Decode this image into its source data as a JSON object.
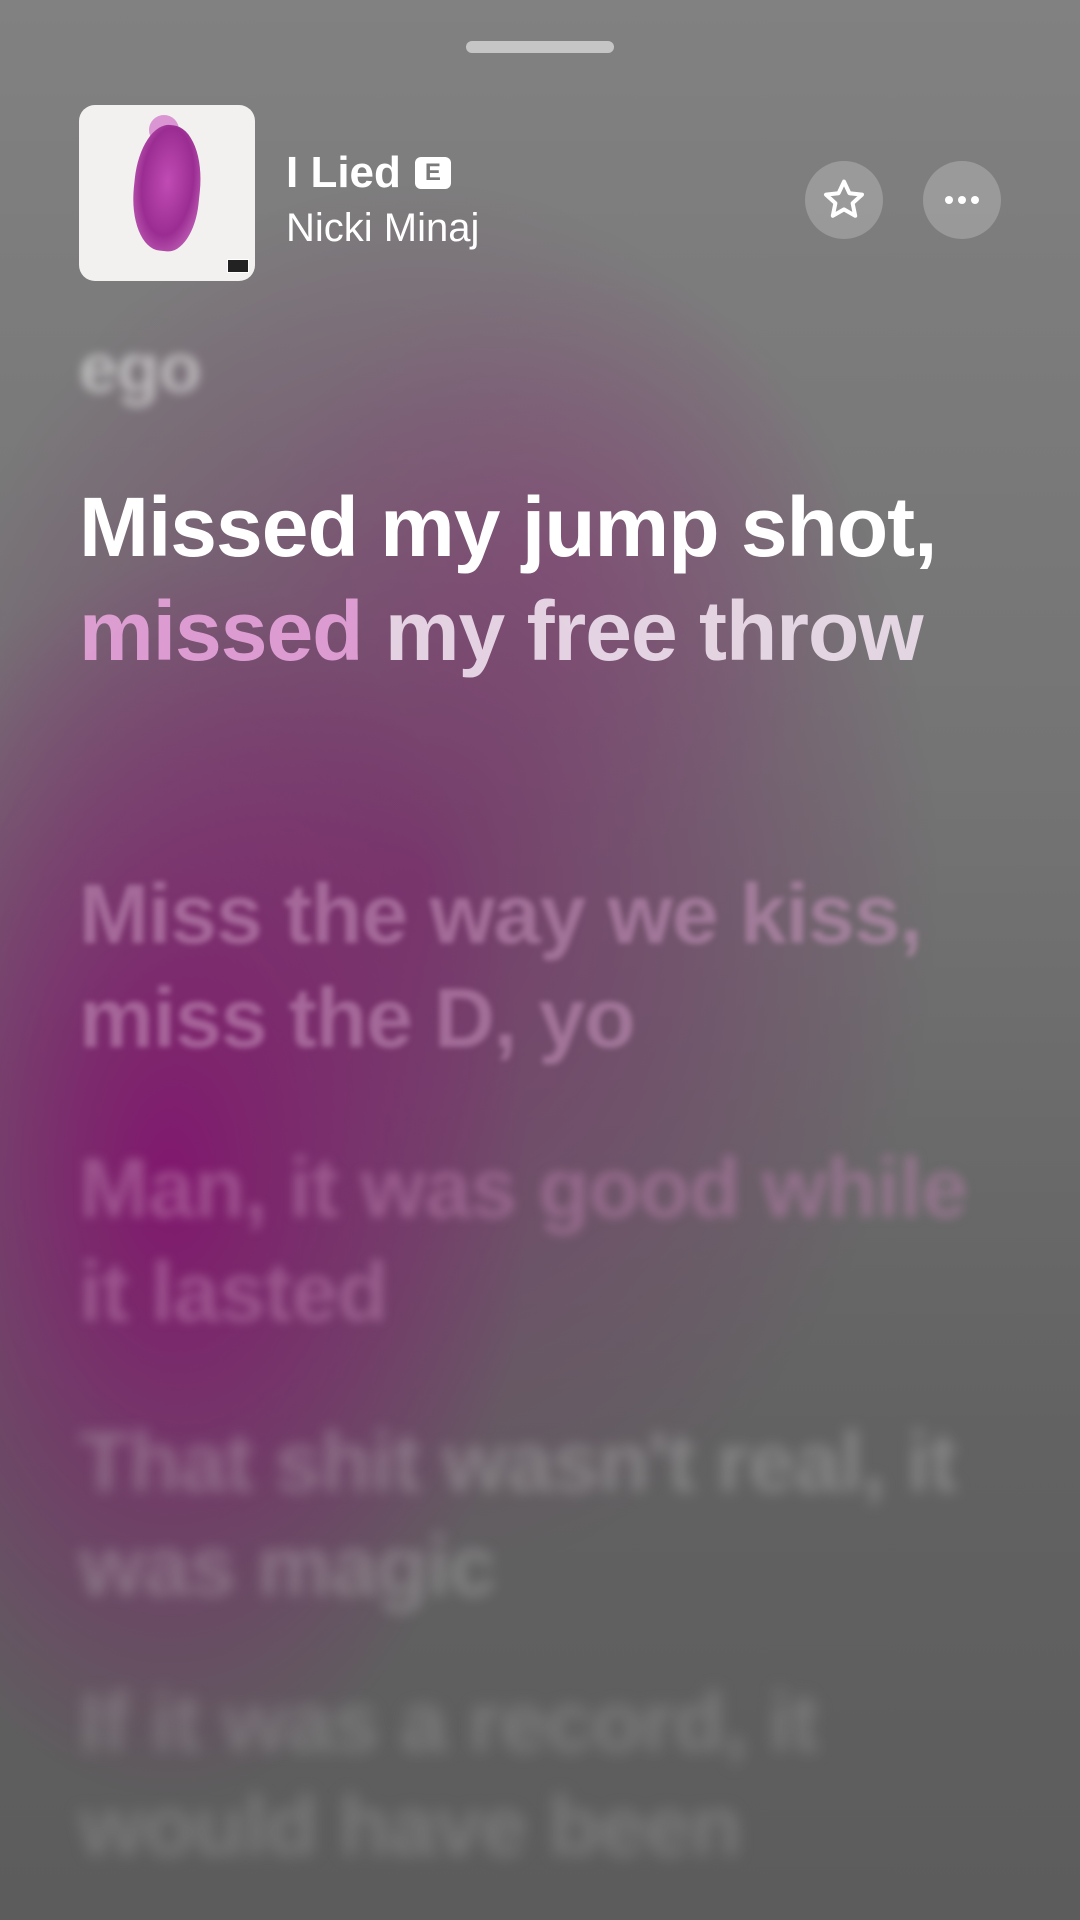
{
  "now_playing": {
    "title": "I Lied",
    "explicit_badge": "E",
    "artist": "Nicki Minaj"
  },
  "lyrics": {
    "previous": "ego",
    "current_sung": "Missed my jump shot,",
    "current_mid": "missed",
    "current_rest": "my free throw",
    "next": [
      "Miss the way we kiss, miss the D, yo",
      "Man, it was good while it lasted",
      "That shit wasn't real, it was magic",
      "If it was a record, it would have been"
    ]
  },
  "icons": {
    "favorite": "star-icon",
    "more": "ellipsis-icon",
    "grabber": "sheet-grabber"
  },
  "colors": {
    "accent": "#9b2d92",
    "background": "#7a7a7a"
  }
}
